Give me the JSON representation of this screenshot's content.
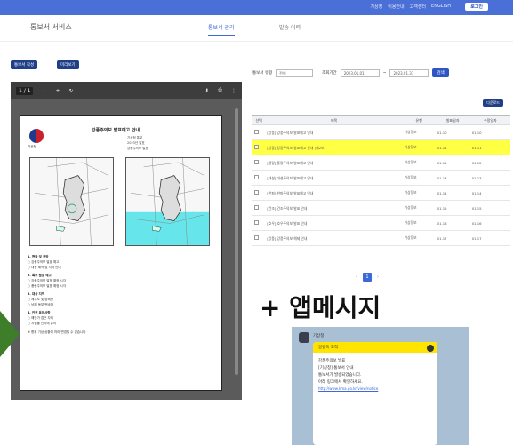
{
  "topbar": {
    "links": [
      "기상청",
      "이용안내",
      "고객센터",
      "ENGLISH"
    ],
    "login_label": "로그인"
  },
  "header": {
    "app_title": "통보서 서비스",
    "tabs": [
      {
        "label": "통보서 관리",
        "active": true
      },
      {
        "label": "발송 이력",
        "active": false
      }
    ]
  },
  "actions": {
    "write_label": "통보서 작성",
    "preview_label": "미리보기"
  },
  "viewer": {
    "page": "1 / 1",
    "zoom_out": "−",
    "zoom_in": "+",
    "rotate": "↻",
    "download": "⬇",
    "print": "⎙",
    "more": "⋮"
  },
  "document": {
    "org": "기상청",
    "title": "강풍주의보 발표예고 안내",
    "meta": [
      "기상청 통보",
      "2023년 발표",
      "강풍주의보 발표"
    ],
    "sections": [
      {
        "heading": "1. 현황 및 전망",
        "lines": [
          "○ 강풍주의보 발효 예고",
          "○ 대상 해역 및 지역 안내"
        ]
      },
      {
        "heading": "2. 특보 발표 예고",
        "lines": [
          "○ 강풍주의보 발표 예정 시각",
          "○ 풍랑주의보 발표 예정 시각"
        ]
      },
      {
        "heading": "3. 대상 지역",
        "lines": [
          "○ 제주도 및 남해안",
          "○ 남해 동부 먼바다"
        ]
      },
      {
        "heading": "4. 안전 유의사항",
        "lines": [
          "○ 해안가 접근 자제",
          "○ 시설물 관리에 유의"
        ]
      }
    ],
    "footer": "※ 향후 기상 상황에 따라 변경될 수 있습니다"
  },
  "filter": {
    "type_label": "통보서 유형",
    "type_value": "전체",
    "period_label": "조회기간",
    "from": "2023.01.01",
    "to": "2023.01.31",
    "search_label": "검색"
  },
  "list": {
    "download_label": "다운로드",
    "columns": [
      "선택",
      "제목",
      "유형",
      "발표일자",
      "수정일자"
    ],
    "rows": [
      {
        "title": "[강풍] 강풍주의보 발표예고 안내",
        "type": "기상정보",
        "date": "01.10",
        "mod": "01.10",
        "highlight": false
      },
      {
        "title": "[강풍] 강풍주의보 발표예고 안내 (제2보)",
        "type": "기상정보",
        "date": "01.11",
        "mod": "01.11",
        "highlight": true
      },
      {
        "title": "[풍랑] 풍랑주의보 발표예고 안내",
        "type": "기상정보",
        "date": "01.12",
        "mod": "01.12",
        "highlight": false
      },
      {
        "title": "[대설] 대설주의보 발표예고 안내",
        "type": "기상정보",
        "date": "01.13",
        "mod": "01.13",
        "highlight": false
      },
      {
        "title": "[한파] 한파주의보 발표예고 안내",
        "type": "기상정보",
        "date": "01.14",
        "mod": "01.14",
        "highlight": false
      },
      {
        "title": "[건조] 건조주의보 발표 안내",
        "type": "기상정보",
        "date": "01.15",
        "mod": "01.15",
        "highlight": false
      },
      {
        "title": "[호우] 호우주의보 발표 안내",
        "type": "기상정보",
        "date": "01.16",
        "mod": "01.16",
        "highlight": false
      },
      {
        "title": "[강풍] 강풍주의보 해제 안내",
        "type": "기상정보",
        "date": "01.17",
        "mod": "01.17",
        "highlight": false
      }
    ]
  },
  "pager": {
    "prev": "‹",
    "current": "1",
    "next": "›"
  },
  "promo": {
    "plus_text": "+ 앱메시지"
  },
  "message": {
    "sender": "기상청",
    "header": "알림톡 도착",
    "lines": [
      "강풍주의보 발표",
      "[기상청] 통보서 안내",
      "통보서가 발송되었습니다.",
      "아래 링크에서 확인하세요."
    ],
    "link": "http://www.kma.go.kr/view/notice"
  },
  "colors": {
    "brand": "#4a6fd6",
    "dark_button": "#1f3f86",
    "highlight": "#ffff44",
    "kakao_yellow": "#ffe400",
    "arrow": "#3e7d2a"
  }
}
